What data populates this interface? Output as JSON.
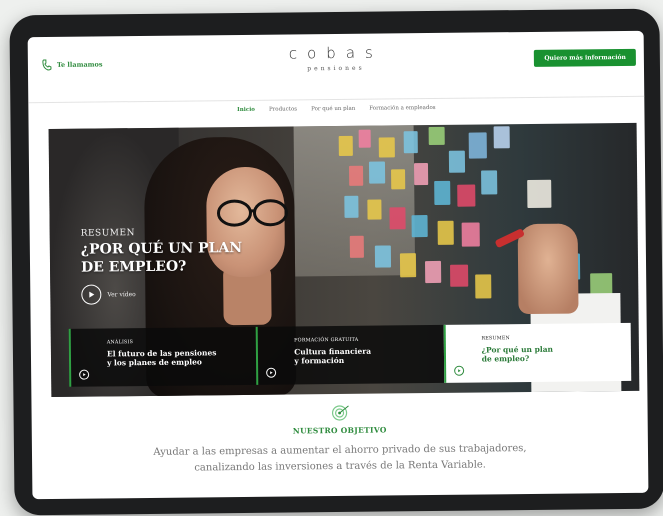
{
  "header": {
    "call_label": "Te llamamos",
    "logo_main": "cobas",
    "logo_sub": "pensiones",
    "cta_label": "Quiero más información"
  },
  "nav": {
    "items": [
      "Inicio",
      "Productos",
      "Por qué un plan",
      "Formación a empleados"
    ],
    "active_index": 0
  },
  "hero": {
    "kicker": "RESUMEN",
    "title_line1": "¿POR QUÉ UN PLAN",
    "title_line2": "DE EMPLEO?",
    "video_label": "Ver vídeo"
  },
  "cards": [
    {
      "kicker": "ANÁLISIS",
      "title_line1": "El futuro de las pensiones",
      "title_line2": "y los planes de empleo",
      "style": "dark"
    },
    {
      "kicker": "FORMACIÓN GRATUITA",
      "title_line1": "Cultura financiera",
      "title_line2": "y formación",
      "style": "dark"
    },
    {
      "kicker": "RESUMEN",
      "title_line1": "¿Por qué un plan",
      "title_line2": "de empleo?",
      "style": "light"
    }
  ],
  "objective": {
    "title": "NUESTRO OBJETIVO",
    "text_line1": "Ayudar a las empresas a aumentar el ahorro privado de sus trabajadores,",
    "text_line2": "canalizando las inversiones a través de la Renta Variable."
  },
  "colors": {
    "brand_green": "#199130",
    "text_green": "#2e8b3d"
  },
  "icons": [
    "phone-icon",
    "play-icon",
    "target-icon"
  ]
}
